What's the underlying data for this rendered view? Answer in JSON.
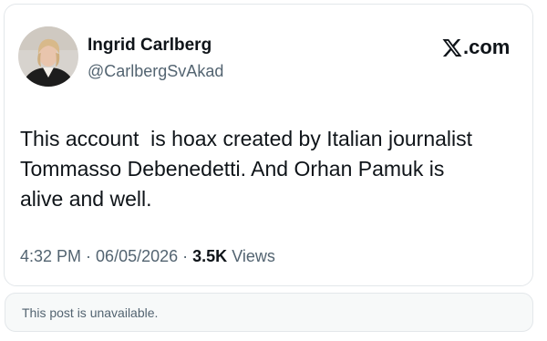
{
  "post": {
    "author_name": "Ingrid Carlberg",
    "author_handle": "@CarlbergSvAkad",
    "brand_label": ".com",
    "brand_icon": "x-logo-icon",
    "text": "This account  is hoax created by Italian journalist\nTommasso Debenedetti. And Orhan Pamuk is\nalive and well.",
    "time": "4:32 PM",
    "separator": " · ",
    "date": "06/05/2026",
    "views_count": "3.5K",
    "views_label": "Views"
  },
  "unavailable_notice": {
    "text": "This post is unavailable."
  },
  "colors": {
    "text_primary": "#0f1419",
    "text_secondary": "#536471",
    "border": "#e3e7ea",
    "notice_background": "#f7f9f9"
  }
}
